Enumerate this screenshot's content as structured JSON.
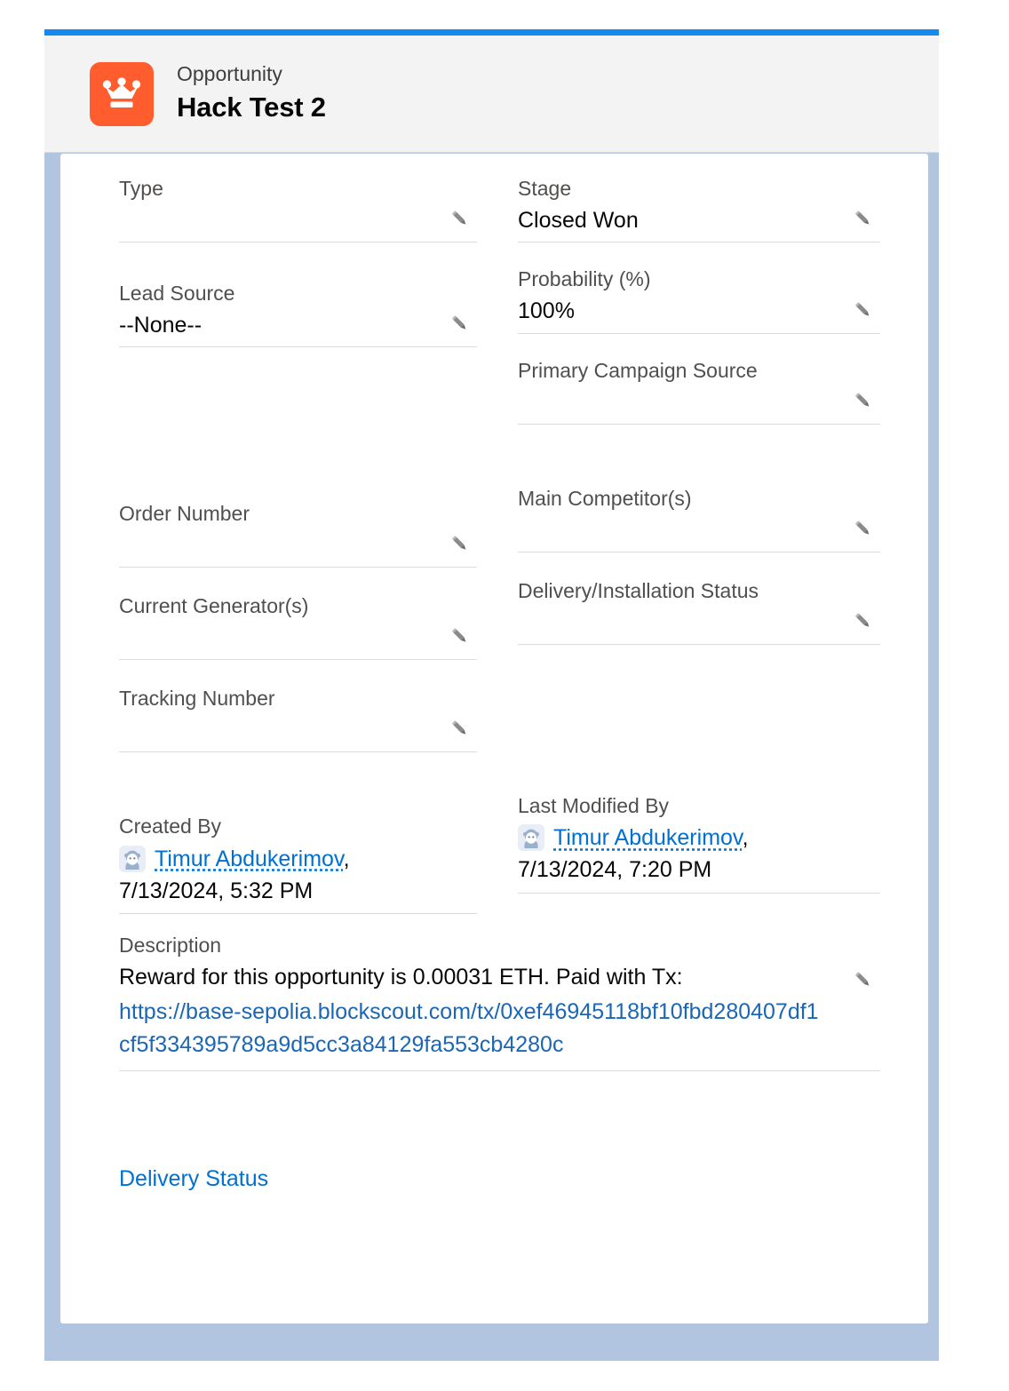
{
  "header": {
    "object_label": "Opportunity",
    "record_title": "Hack Test 2",
    "icon": "crown-icon",
    "icon_color": "#ff5d2d",
    "accent_color": "#1589ee"
  },
  "fields": {
    "type": {
      "label": "Type",
      "value": ""
    },
    "stage": {
      "label": "Stage",
      "value": "Closed Won"
    },
    "lead_source": {
      "label": "Lead Source",
      "value": "--None--"
    },
    "probability": {
      "label": "Probability (%)",
      "value": "100%"
    },
    "primary_campaign_source": {
      "label": "Primary Campaign Source",
      "value": ""
    },
    "order_number": {
      "label": "Order Number",
      "value": ""
    },
    "main_competitors": {
      "label": "Main Competitor(s)",
      "value": ""
    },
    "current_generators": {
      "label": "Current Generator(s)",
      "value": ""
    },
    "delivery_installation_status": {
      "label": "Delivery/Installation Status",
      "value": ""
    },
    "tracking_number": {
      "label": "Tracking Number",
      "value": ""
    },
    "created_by": {
      "label": "Created By",
      "user": "Timur Abdukerimov",
      "separator": ",",
      "timestamp": "7/13/2024, 5:32 PM"
    },
    "last_modified_by": {
      "label": "Last Modified By",
      "user": "Timur Abdukerimov",
      "separator": ",",
      "timestamp": "7/13/2024, 7:20 PM"
    },
    "description": {
      "label": "Description",
      "text": "Reward for this opportunity is 0.00031 ETH. Paid with Tx:",
      "url": "https://base-sepolia.blockscout.com/tx/0xef46945118bf10fbd280407df1cf5f334395789a9d5cc3a84129fa553cb4280c"
    },
    "delivery_status": {
      "label": "Delivery Status"
    }
  },
  "icons": {
    "edit": "pencil-icon",
    "avatar": "user-avatar-icon"
  },
  "colors": {
    "link": "#0070d2",
    "url_link": "#1b66b5",
    "label_text": "#514f4d",
    "value_text": "#080707",
    "frame": "#b2c5e0",
    "header_bg": "#f3f3f3",
    "divider": "#dddbda"
  }
}
